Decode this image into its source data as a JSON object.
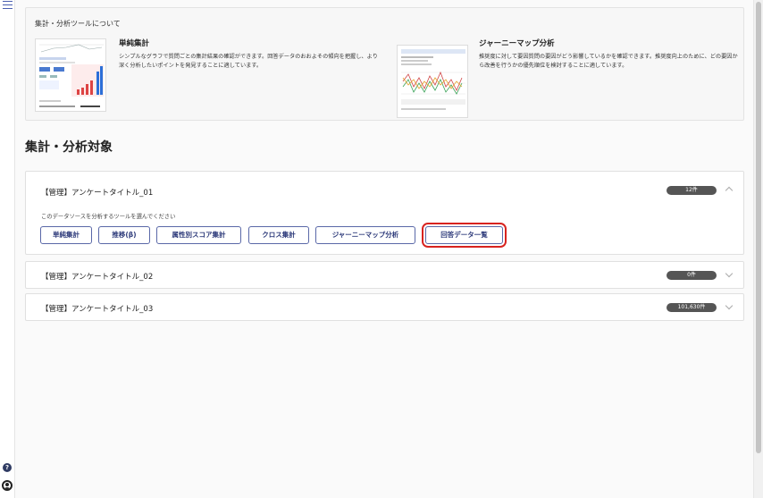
{
  "about": {
    "title": "集計・分析ツールについて",
    "tools": [
      {
        "name": "単純集計",
        "description": "シンプルなグラフで質問ごとの集計結果の確認ができます。回答データのおおよその傾向を把握し、より深く分析したいポイントを発見することに適しています。"
      },
      {
        "name": "ジャーニーマップ分析",
        "description": "推奨度に対して要因質問の要因がどう影響しているかを確認できます。推奨度向上のために、どの要因から改善を行うかの優先順位を検討することに適しています。"
      }
    ]
  },
  "section_title": "集計・分析対象",
  "datasources": [
    {
      "name": "【管理】アンケートタイトル_01",
      "count": "12件",
      "expanded": true,
      "hint": "このデータソースを分析するツールを選んでください",
      "buttons": [
        "単純集計",
        "推移(β)",
        "属性別スコア集計",
        "クロス集計",
        "ジャーニーマップ分析",
        "回答データ一覧"
      ]
    },
    {
      "name": "【管理】アンケートタイトル_02",
      "count": "0件",
      "expanded": false
    },
    {
      "name": "【管理】アンケートタイトル_03",
      "count": "101,630件",
      "expanded": false
    }
  ],
  "icons": {
    "menu": "hamburger-menu-icon",
    "help": "question-circle-icon",
    "user": "user-circle-icon"
  },
  "colors": {
    "accent": "#2d3a7a",
    "highlight": "#d8231f",
    "badge": "#555555"
  }
}
